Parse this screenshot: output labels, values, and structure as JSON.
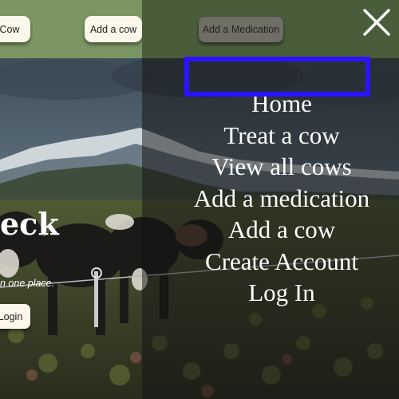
{
  "header": {
    "nav_cow_label": "Cow",
    "nav_add_cow_label": "Add a cow"
  },
  "hero": {
    "title_fragment": "eck",
    "subtitle_fragment": "n one place.",
    "login_label": "Login"
  },
  "menu": {
    "add_medication_label": "Add a Medication",
    "items": [
      {
        "label": "Home"
      },
      {
        "label": "Treat a cow"
      },
      {
        "label": "View all cows"
      },
      {
        "label": "Add a medication"
      },
      {
        "label": "Add a cow"
      },
      {
        "label": "Create Account"
      },
      {
        "label": "Log In"
      }
    ],
    "highlighted_item": "View all cows"
  },
  "colors": {
    "header_green": "#7b9563",
    "menu_header_green": "#4a5d3b",
    "pill_cream": "#fbf7ea",
    "highlight_blue": "#2b14ff"
  },
  "icons": {
    "close": "close-icon"
  }
}
